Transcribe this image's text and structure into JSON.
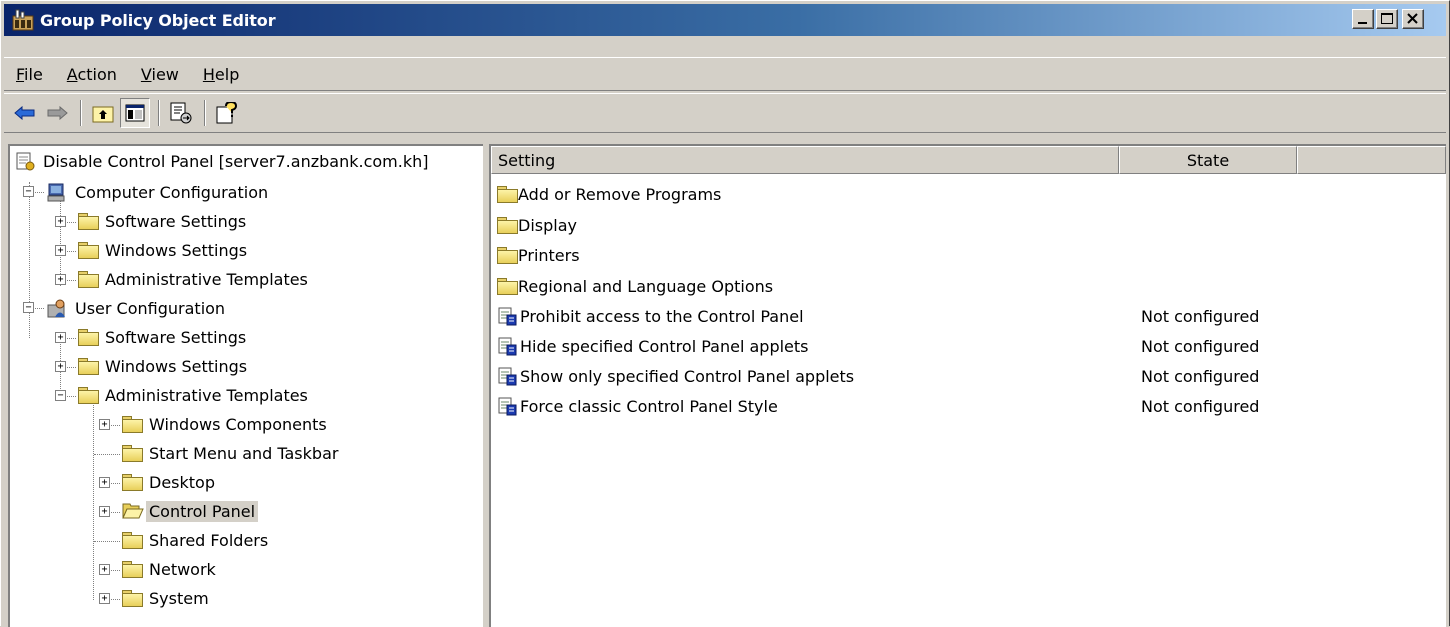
{
  "window": {
    "title": "Group Policy Object Editor"
  },
  "menu": {
    "items": [
      {
        "accel": "F",
        "rest": "ile"
      },
      {
        "accel": "A",
        "rest": "ction"
      },
      {
        "accel": "V",
        "rest": "iew"
      },
      {
        "accel": "H",
        "rest": "elp"
      }
    ]
  },
  "tree": {
    "root": "Disable Control Panel [server7.anzbank.com.kh]",
    "computer_config": "Computer Configuration",
    "cc_software": "Software Settings",
    "cc_windows": "Windows Settings",
    "cc_admin": "Administrative Templates",
    "user_config": "User Configuration",
    "uc_software": "Software Settings",
    "uc_windows": "Windows Settings",
    "uc_admin": "Administrative Templates",
    "windows_components": "Windows Components",
    "start_menu": "Start Menu and Taskbar",
    "desktop": "Desktop",
    "control_panel": "Control Panel",
    "shared_folders": "Shared Folders",
    "network": "Network",
    "system": "System"
  },
  "list": {
    "headers": {
      "setting": "Setting",
      "state": "State",
      "extra": ""
    },
    "folders": [
      "Add or Remove Programs",
      "Display",
      "Printers",
      "Regional and Language Options"
    ],
    "policies": [
      {
        "name": "Prohibit access to the Control Panel",
        "state": "Not configured"
      },
      {
        "name": "Hide specified Control Panel applets",
        "state": "Not configured"
      },
      {
        "name": "Show only specified Control Panel applets",
        "state": "Not configured"
      },
      {
        "name": "Force classic Control Panel Style",
        "state": "Not configured"
      }
    ]
  },
  "colors": {
    "titlebar_start": "#0a246a",
    "titlebar_end": "#a6caf0",
    "face": "#d4d0c8"
  }
}
